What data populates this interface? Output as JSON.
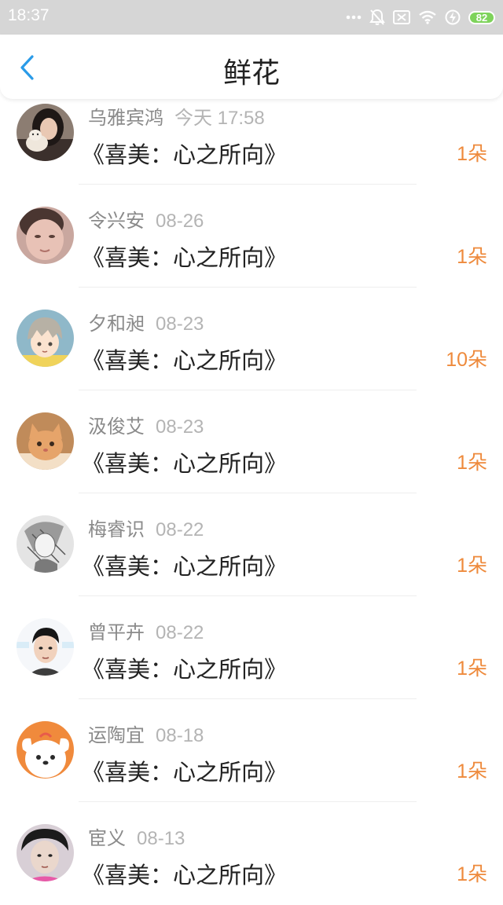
{
  "status_bar": {
    "time": "18:37",
    "battery": "82",
    "icons": [
      "more-dots-icon",
      "mute-bell-icon",
      "sim-off-icon",
      "wifi-icon",
      "charging-icon",
      "battery-icon"
    ]
  },
  "nav": {
    "title": "鲜花",
    "back_icon": "chevron-left-icon",
    "accent_color": "#2a9be8"
  },
  "colors": {
    "count": "#ee8a3c",
    "name": "#8a8a8a",
    "date": "#b4b4b4",
    "title": "#222222"
  },
  "records": [
    {
      "name": "乌雅宾鸿",
      "date": "今天 17:58",
      "book": "《喜美：心之所向》",
      "count": "1朵",
      "avatar": "photo-woman-with-cat"
    },
    {
      "name": "令兴安",
      "date": "08-26",
      "book": "《喜美：心之所向》",
      "count": "1朵",
      "avatar": "photo-woman-face"
    },
    {
      "name": "夕和昶",
      "date": "08-23",
      "book": "《喜美：心之所向》",
      "count": "10朵",
      "avatar": "cartoon-boy"
    },
    {
      "name": "汲俊艾",
      "date": "08-23",
      "book": "《喜美：心之所向》",
      "count": "1朵",
      "avatar": "kitten-photo"
    },
    {
      "name": "梅睿识",
      "date": "08-22",
      "book": "《喜美：心之所向》",
      "count": "1朵",
      "avatar": "anime-sketch"
    },
    {
      "name": "曾平卉",
      "date": "08-22",
      "book": "《喜美：心之所向》",
      "count": "1朵",
      "avatar": "photo-young-man"
    },
    {
      "name": "运陶宜",
      "date": "08-18",
      "book": "《喜美：心之所向》",
      "count": "1朵",
      "avatar": "cartoon-dog"
    },
    {
      "name": "宦义",
      "date": "08-13",
      "book": "《喜美：心之所向》",
      "count": "1朵",
      "avatar": "photo-boy-face"
    }
  ]
}
